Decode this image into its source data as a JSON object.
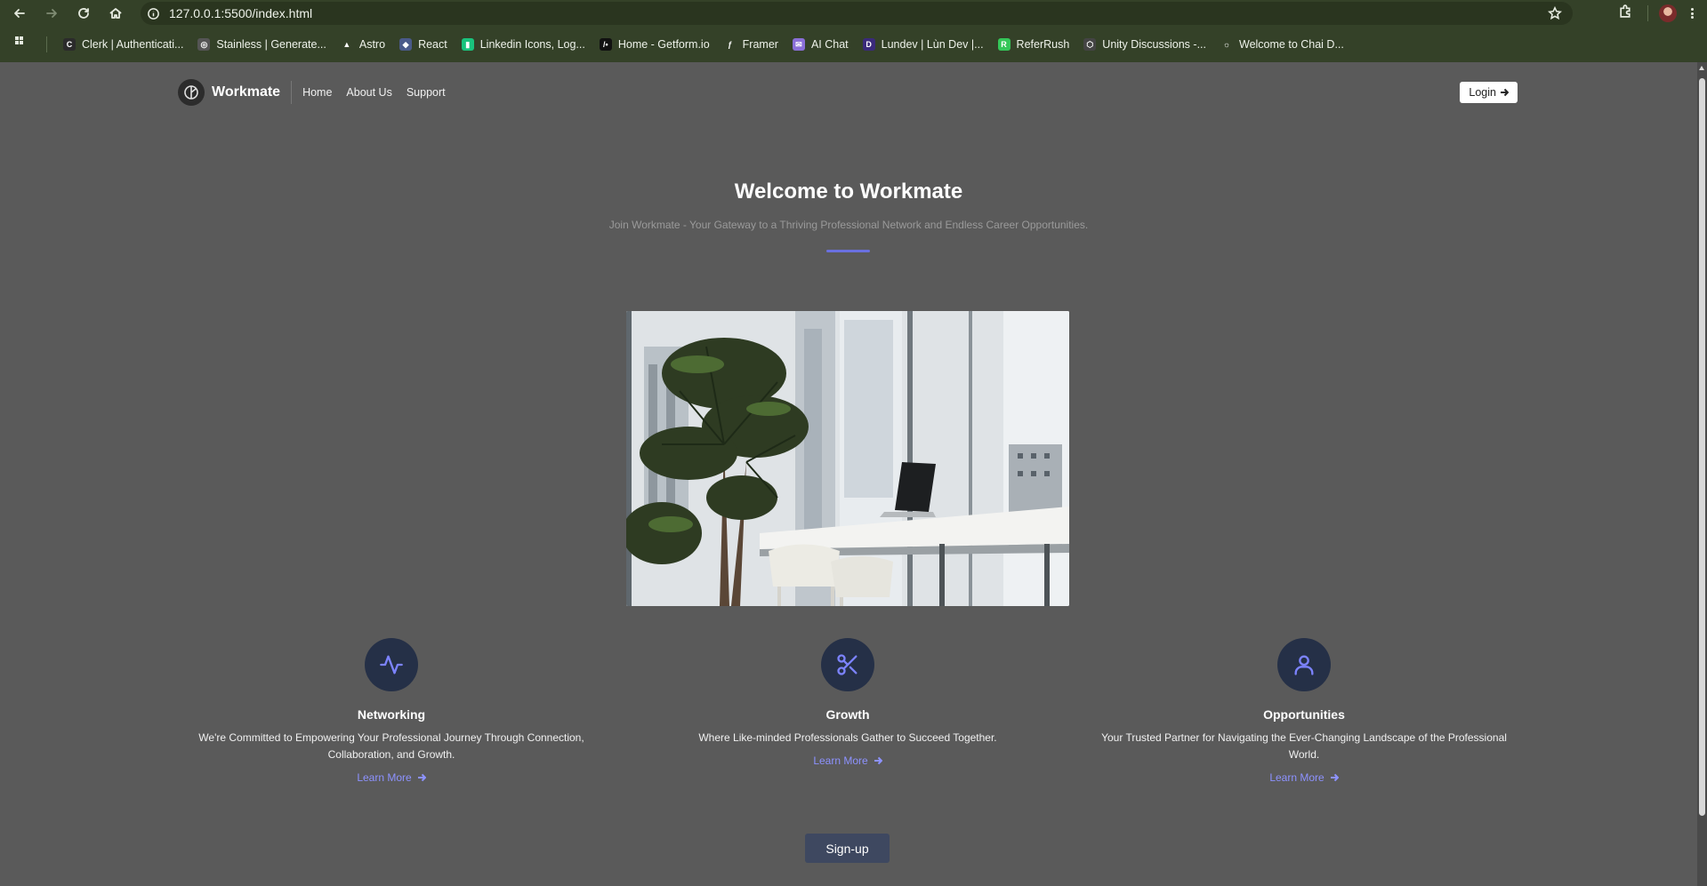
{
  "browser": {
    "url": "127.0.0.1:5500/index.html",
    "bookmarks": [
      {
        "label": "Clerk | Authenticati...",
        "icon": "clerk-icon",
        "color": "#2b2b2b",
        "glyph": "C"
      },
      {
        "label": "Stainless | Generate...",
        "icon": "globe-icon",
        "color": "#555555",
        "glyph": "◎"
      },
      {
        "label": "Astro",
        "icon": "astro-icon",
        "color": "#344128",
        "glyph": "▲"
      },
      {
        "label": "React",
        "icon": "react-icon",
        "color": "#4a5a8a",
        "glyph": "◆"
      },
      {
        "label": "Linkedin Icons, Log...",
        "icon": "linkedin-icons-icon",
        "color": "#19c37d",
        "glyph": "▮"
      },
      {
        "label": "Home - Getform.io",
        "icon": "getform-icon",
        "color": "#111111",
        "glyph": "/•"
      },
      {
        "label": "Framer",
        "icon": "framer-icon",
        "color": "#344128",
        "glyph": "ƒ"
      },
      {
        "label": "AI Chat",
        "icon": "ai-chat-icon",
        "color": "#8a6fd8",
        "glyph": "✉"
      },
      {
        "label": "Lundev | Lùn Dev |...",
        "icon": "lundev-icon",
        "color": "#3a2a7a",
        "glyph": "D"
      },
      {
        "label": "ReferRush",
        "icon": "referrush-icon",
        "color": "#34c759",
        "glyph": "R"
      },
      {
        "label": "Unity Discussions -...",
        "icon": "unity-icon",
        "color": "#444444",
        "glyph": "⬡"
      },
      {
        "label": "Welcome to Chai D...",
        "icon": "chai-icon",
        "color": "#344128",
        "glyph": "☼"
      }
    ]
  },
  "header": {
    "brand": "Workmate",
    "nav": [
      "Home",
      "About Us",
      "Support"
    ],
    "login_label": "Login"
  },
  "hero": {
    "title": "Welcome to Workmate",
    "subtitle": "Join Workmate - Your Gateway to a Thriving Professional Network and Endless Career Opportunities.",
    "accent_color": "#6a70e0"
  },
  "features": [
    {
      "icon": "activity-icon",
      "title": "Networking",
      "description": "We're Committed to Empowering Your Professional Journey Through Connection, Collaboration, and Growth.",
      "link_label": "Learn More"
    },
    {
      "icon": "scissors-icon",
      "title": "Growth",
      "description": "Where Like-minded Professionals Gather to Succeed Together.",
      "link_label": "Learn More"
    },
    {
      "icon": "user-icon",
      "title": "Opportunities",
      "description": "Your Trusted Partner for Navigating the Ever-Changing Landscape of the Professional World.",
      "link_label": "Learn More"
    }
  ],
  "signup_label": "Sign-up"
}
